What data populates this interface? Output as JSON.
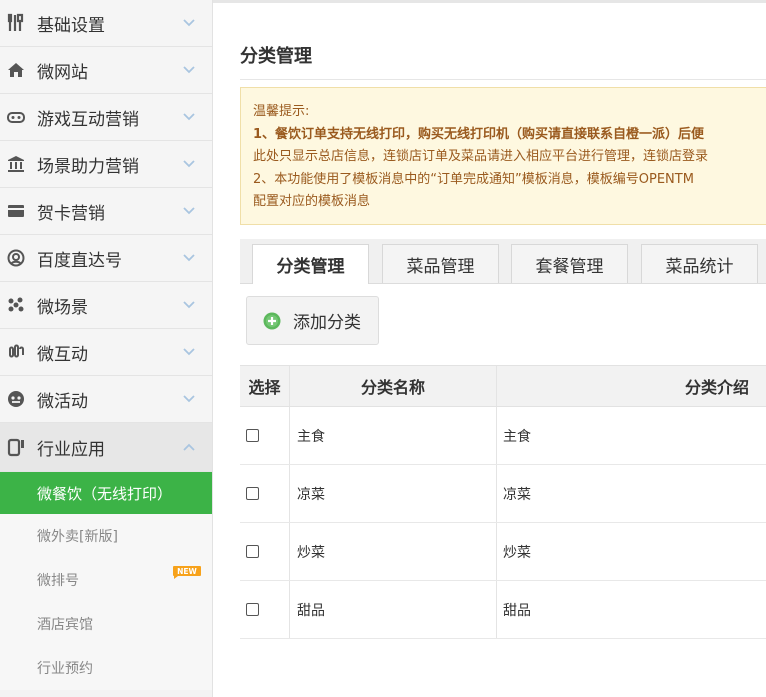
{
  "sidebar": {
    "items": [
      {
        "label": "基础设置",
        "icon": "tools-icon"
      },
      {
        "label": "微网站",
        "icon": "home-icon"
      },
      {
        "label": "游戏互动营销",
        "icon": "gamepad-icon"
      },
      {
        "label": "场景助力营销",
        "icon": "bank-icon"
      },
      {
        "label": "贺卡营销",
        "icon": "card-icon"
      },
      {
        "label": "百度直达号",
        "icon": "target-icon"
      },
      {
        "label": "微场景",
        "icon": "flower-icon"
      },
      {
        "label": "微互动",
        "icon": "link-icon"
      },
      {
        "label": "微活动",
        "icon": "mascot-icon"
      },
      {
        "label": "行业应用",
        "icon": "phone-icon"
      }
    ],
    "sub_items": [
      {
        "label": "微餐饮（无线打印）"
      },
      {
        "label": "微外卖[新版]"
      },
      {
        "label": "微排号"
      },
      {
        "label": "酒店宾馆"
      },
      {
        "label": "行业预约"
      }
    ],
    "new_badge": "NEW"
  },
  "main": {
    "title": "分类管理",
    "notice": {
      "heading": "温馨提示:",
      "line1": "1、餐饮订单支持无线打印，购买无线打印机（购买请直接联系自橙一派）后便",
      "line2": "此处只显示总店信息，连锁店订单及菜品请进入相应平台进行管理，连锁店登录",
      "line3": "2、本功能使用了模板消息中的“订单完成通知”模板消息，模板编号OPENTM",
      "line4": "配置对应的模板消息"
    },
    "tabs": [
      {
        "label": "分类管理"
      },
      {
        "label": "菜品管理"
      },
      {
        "label": "套餐管理"
      },
      {
        "label": "菜品统计"
      }
    ],
    "add_button": "添加分类",
    "table": {
      "headers": [
        "选择",
        "分类名称",
        "分类介绍"
      ],
      "rows": [
        {
          "name": "主食",
          "intro": "主食"
        },
        {
          "name": "凉菜",
          "intro": "凉菜"
        },
        {
          "name": "炒菜",
          "intro": "炒菜"
        },
        {
          "name": "甜品",
          "intro": "甜品"
        }
      ]
    }
  },
  "colors": {
    "accent_green": "#3cb347",
    "notice_bg": "#fef8e0",
    "notice_text": "#9a5a1e",
    "chevron": "#a9c5e0",
    "new_badge": "#f7a21b"
  }
}
